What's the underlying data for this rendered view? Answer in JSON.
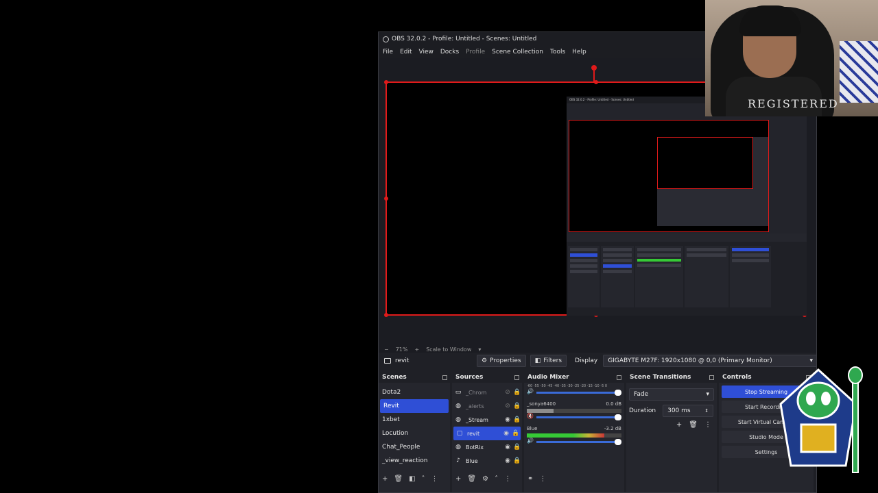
{
  "window": {
    "title": "OBS 32.0.2 - Profile: Untitled - Scenes: Untitled"
  },
  "menu": {
    "items": [
      "File",
      "Edit",
      "View",
      "Docks",
      "Profile",
      "Scene Collection",
      "Tools",
      "Help"
    ]
  },
  "preview": {
    "zoom_minus": "−",
    "zoom": "71%",
    "zoom_plus": "+",
    "scale_mode": "Scale to Window",
    "scale_caret": "▾"
  },
  "context_bar": {
    "source_name": "revit",
    "properties_label": "Properties",
    "filters_label": "Filters",
    "display_label": "Display",
    "display_value": "GIGABYTE M27F: 1920x1080 @ 0,0 (Primary Monitor)"
  },
  "scenes": {
    "title": "Scenes",
    "items": [
      {
        "label": "Dota2",
        "active": false
      },
      {
        "label": "Revit",
        "active": true
      },
      {
        "label": "1xbet",
        "active": false
      },
      {
        "label": "Locution",
        "active": false
      },
      {
        "label": "Chat_People",
        "active": false
      },
      {
        "label": "_view_reaction",
        "active": false
      }
    ]
  },
  "sources": {
    "title": "Sources",
    "items": [
      {
        "label": "_Chrom",
        "icon": "browser-icon",
        "glyph": "▭",
        "visible": false
      },
      {
        "label": "_alerts",
        "icon": "globe-icon",
        "glyph": "◍",
        "visible": false
      },
      {
        "label": "_Stream",
        "icon": "globe-icon",
        "glyph": "◍",
        "visible": true
      },
      {
        "label": "revit",
        "icon": "monitor-icon",
        "glyph": "▢",
        "visible": true,
        "active": true
      },
      {
        "label": "BotRix",
        "icon": "globe-icon",
        "glyph": "◍",
        "visible": true
      },
      {
        "label": "Blue",
        "icon": "microphone-icon",
        "glyph": "♪",
        "visible": true
      }
    ]
  },
  "audio_mixer": {
    "title": "Audio Mixer",
    "scale_top": "-60 -55 -50 -45 -40 -35 -30 -25 -20 -15 -10 -5 0",
    "channels": [
      {
        "name": "_sonya6400",
        "db": "0.0 dB",
        "level": 0.28
      },
      {
        "name": "Blue",
        "db": "-3.2 dB",
        "level": 0.82
      }
    ]
  },
  "scene_transitions": {
    "title": "Scene Transitions",
    "transition": "Fade",
    "duration_label": "Duration",
    "duration_value": "300 ms"
  },
  "controls": {
    "title": "Controls",
    "buttons": [
      "Stop Streaming",
      "Start Recording",
      "Start Virtual Camera",
      "Studio Mode",
      "Settings"
    ]
  },
  "webcam": {
    "chair_text": "REGISTERED"
  },
  "colors": {
    "accent": "#2f4fd6",
    "selection_border": "#e01a1a"
  }
}
